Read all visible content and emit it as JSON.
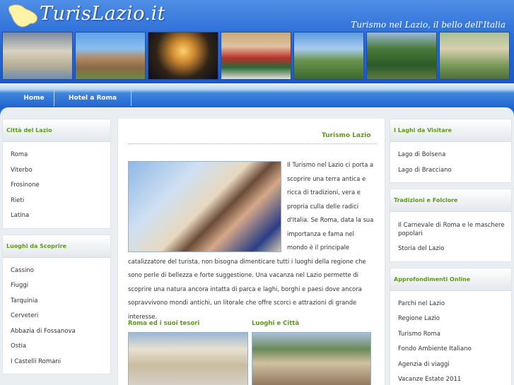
{
  "header": {
    "logo_text": "TurisLazio.it",
    "tagline": "Turismo nel Lazio, il bello dell'Italia"
  },
  "nav": {
    "items": [
      {
        "label": "Home"
      },
      {
        "label": "Hotel a Roma"
      }
    ]
  },
  "sidebar_left": {
    "boxes": [
      {
        "title": "Città del Lazio",
        "items": [
          "Roma",
          "Viterbo",
          "Frosinone",
          "Rieti",
          "Latina"
        ]
      },
      {
        "title": "Luoghi da Scoprire",
        "items": [
          "Cassino",
          "Fiuggi",
          "Tarquinia",
          "Cerveteri",
          "Abbazia di Fossanova",
          "Ostia",
          "I Castelli Romani"
        ]
      }
    ]
  },
  "sidebar_right": {
    "boxes": [
      {
        "title": "I Laghi da Visitare",
        "items": [
          "Lago di Bolsena",
          "Lago di Bracciano"
        ]
      },
      {
        "title": "Tradizioni e Folclore",
        "items": [
          "Il Carnevale di Roma e le maschere popolari",
          "Storia del Lazio"
        ]
      },
      {
        "title": "Approfondimenti Online",
        "items": [
          "Parchi nel Lazio",
          "Regione Lazio",
          "Turismo Roma",
          "Fondo Ambiente Italiano",
          "Agenzia di viaggi",
          "Vacanze Estate 2011"
        ]
      }
    ]
  },
  "main": {
    "title": "Turismo Lazio",
    "intro": "Il Turismo nel Lazio ci porta a scoprire una terra antica e ricca di tradizioni, vera e propria culla delle radici d'Italia. Se Roma, data la sua importanza e fama nel mondo è il principale catalizzatore del turista, non bisogna dimenticare tutti i luoghi della regione che sono perle di bellezza e forte suggestione. Una vacanza nel Lazio permette di scoprire una natura ancora intatta di parca e laghi, borghi e paesi dove ancora sopravvivono mondi antichi, un litorale che offre scorci e attrazioni di grande interesse.",
    "sections": [
      {
        "title": "Roma ed i suoi tesori"
      },
      {
        "title": "Luoghi e Città"
      }
    ]
  }
}
